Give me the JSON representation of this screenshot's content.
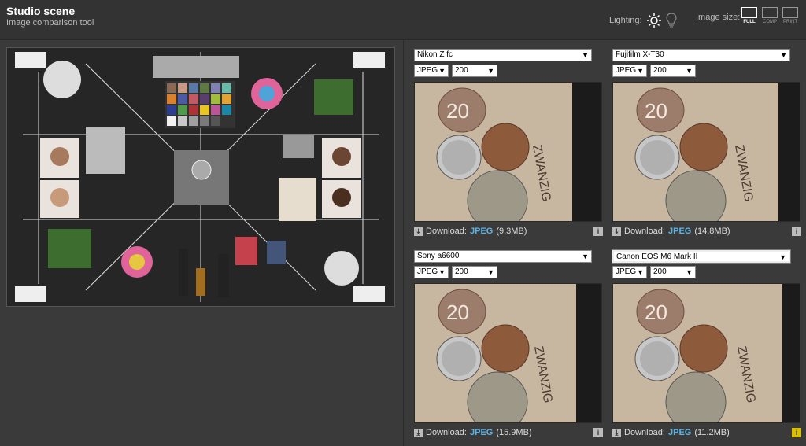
{
  "header": {
    "title": "Studio scene",
    "subtitle": "Image comparison tool",
    "lighting_label": "Lighting:",
    "image_size_label": "Image size:",
    "sizes": [
      {
        "label": "FULL",
        "active": true
      },
      {
        "label": "COMP",
        "active": false
      },
      {
        "label": "PRINT",
        "active": false
      }
    ]
  },
  "panels": [
    {
      "camera": "Nikon Z fc",
      "format": "JPEG",
      "iso": "200",
      "download_label": "Download:",
      "download_type": "JPEG",
      "download_size": "(9.3MB)",
      "active": false,
      "info_highlight": false
    },
    {
      "camera": "Fujifilm X-T30",
      "format": "JPEG",
      "iso": "200",
      "download_label": "Download:",
      "download_type": "JPEG",
      "download_size": "(14.8MB)",
      "active": false,
      "info_highlight": false
    },
    {
      "camera": "Sony a6600",
      "format": "JPEG",
      "iso": "200",
      "download_label": "Download:",
      "download_type": "JPEG",
      "download_size": "(15.9MB)",
      "active": false,
      "info_highlight": false
    },
    {
      "camera": "Canon EOS M6 Mark II",
      "format": "JPEG",
      "iso": "200",
      "download_label": "Download:",
      "download_type": "JPEG",
      "download_size": "(11.2MB)",
      "active": true,
      "info_highlight": true
    }
  ],
  "icons": {
    "sun": "sun-icon",
    "bulb": "lightbulb-icon",
    "download": "download-icon",
    "info": "info-icon"
  }
}
